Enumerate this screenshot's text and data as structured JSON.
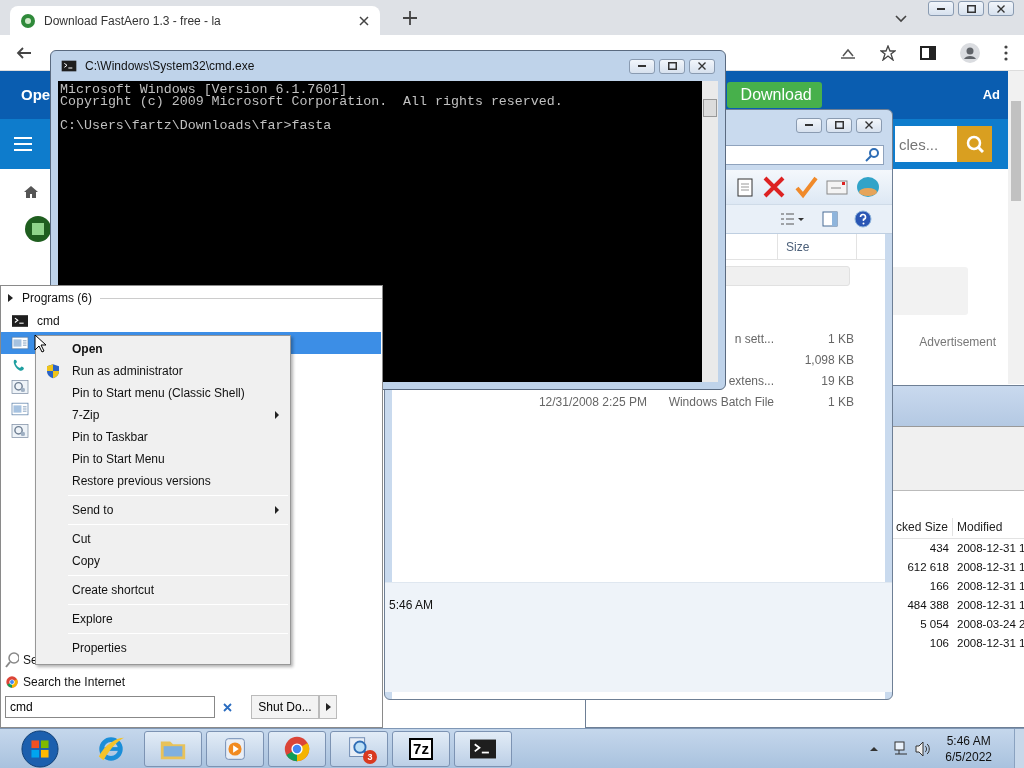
{
  "browser": {
    "tab": {
      "title": "Download FastAero 1.3 - free - la"
    },
    "site": {
      "header_text": "Ope",
      "download_button": "Download",
      "ad_label": "Ad",
      "search_placeholder": "cles...",
      "advertisement": "Advertisement"
    }
  },
  "explorer": {
    "size_header": "Size",
    "rows": [
      {
        "type_text": "n sett...",
        "size": "1 KB"
      },
      {
        "size": "1,098 KB"
      },
      {
        "type_text": "extens...",
        "size": "19 KB"
      },
      {
        "date": "12/31/2008 2:25 PM",
        "type_text": "Windows Batch File",
        "size": "1 KB"
      }
    ],
    "status_time": "5:46 AM"
  },
  "sevenzip": {
    "columns": [
      "cked Size",
      "Modified"
    ],
    "rows": [
      [
        "434",
        "2008-12-31 1"
      ],
      [
        "612 618",
        "2008-12-31 1"
      ],
      [
        "166",
        "2008-12-31 1"
      ],
      [
        "484 388",
        "2008-12-31 1"
      ],
      [
        "5 054",
        "2008-03-24 2"
      ],
      [
        "106",
        "2008-12-31 1"
      ]
    ]
  },
  "cmd": {
    "title": "C:\\Windows\\System32\\cmd.exe",
    "banner": [
      "Microsoft Windows [Version 6.1.7601]",
      "Copyright (c) 2009 Microsoft Corporation.  All rights reserved."
    ],
    "prompt": "C:\\Users\\fartz\\Downloads\\far>fasta"
  },
  "start_menu": {
    "section": "Programs (6)",
    "results": [
      {
        "label": "cmd",
        "kind": "console",
        "selected": false
      },
      {
        "kind": "window",
        "selected": true
      },
      {
        "kind": "phone",
        "selected": false
      },
      {
        "kind": "gear",
        "selected": false
      },
      {
        "kind": "window",
        "selected": false
      },
      {
        "kind": "gear",
        "selected": false
      }
    ],
    "see_more": "Se",
    "search_internet": "Search the Internet",
    "search_value": "cmd",
    "shutdown": "Shut Do..."
  },
  "context_menu": [
    {
      "kind": "item",
      "label": "Open",
      "default": true,
      "submenu": false
    },
    {
      "kind": "admin_item",
      "label": "Run as administrator",
      "default": false,
      "submenu": false
    },
    {
      "kind": "item",
      "label": "Pin to Start menu (Classic Shell)",
      "default": false,
      "submenu": false
    },
    {
      "kind": "item",
      "label": "7-Zip",
      "default": false,
      "submenu": true
    },
    {
      "kind": "item",
      "label": "Pin to Taskbar",
      "default": false,
      "submenu": false
    },
    {
      "kind": "item",
      "label": "Pin to Start Menu",
      "default": false,
      "submenu": false
    },
    {
      "kind": "item",
      "label": "Restore previous versions",
      "default": false,
      "submenu": false
    },
    {
      "kind": "separator"
    },
    {
      "kind": "item",
      "label": "Send to",
      "default": false,
      "submenu": true
    },
    {
      "kind": "separator"
    },
    {
      "kind": "item",
      "label": "Cut",
      "default": false,
      "submenu": false
    },
    {
      "kind": "item",
      "label": "Copy",
      "default": false,
      "submenu": false
    },
    {
      "kind": "separator"
    },
    {
      "kind": "item",
      "label": "Create shortcut",
      "default": false,
      "submenu": false
    },
    {
      "kind": "separator"
    },
    {
      "kind": "item",
      "label": "Explore",
      "default": false,
      "submenu": false
    },
    {
      "kind": "separator"
    },
    {
      "kind": "item",
      "label": "Properties",
      "default": false,
      "submenu": false
    }
  ],
  "taskbar": {
    "buttons": [
      {
        "kind": "ie"
      },
      {
        "kind": "folder"
      },
      {
        "kind": "media"
      },
      {
        "kind": "chrome"
      },
      {
        "kind": "magnifier",
        "badge": "3"
      },
      {
        "kind": "archive",
        "logo_text": "7z"
      },
      {
        "kind": "console"
      }
    ],
    "clock": {
      "time": "5:46 AM",
      "date": "6/5/2022"
    }
  }
}
